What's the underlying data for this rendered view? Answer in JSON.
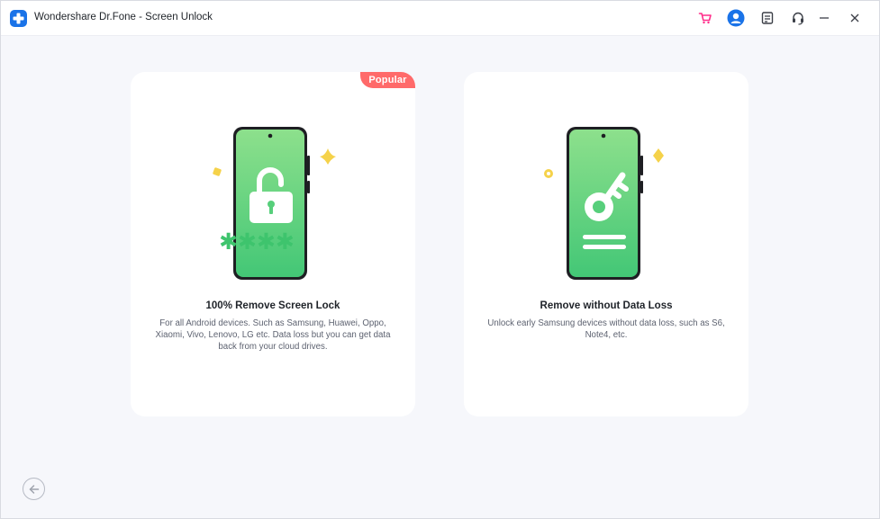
{
  "window": {
    "title": "Wondershare Dr.Fone - Screen Unlock",
    "icons": [
      "cart-icon",
      "account-icon",
      "feedback-icon",
      "headset-icon",
      "minimize-icon",
      "close-icon"
    ]
  },
  "cards": [
    {
      "badge": "Popular",
      "title": "100% Remove Screen Lock",
      "description": "For all Android devices. Such as Samsung, Huawei, Oppo, Xiaomi, Vivo, Lenovo, LG etc. Data loss but you can get data back from your cloud drives.",
      "illustration": "phone-unlock-icon",
      "password_mask": "✱✱✱✱"
    },
    {
      "title": "Remove without Data Loss",
      "description": "Unlock early Samsung devices without data loss, such as S6, Note4, etc.",
      "illustration": "phone-key-icon"
    }
  ],
  "footer": {
    "back_icon": "back-arrow-icon"
  },
  "colors": {
    "accent_blue": "#1a73e8",
    "badge_red": "#ff6a6a",
    "phone_green": "#57cf7b",
    "sparkle_yellow": "#f5d24a",
    "cart_pink": "#ff2d8a"
  }
}
